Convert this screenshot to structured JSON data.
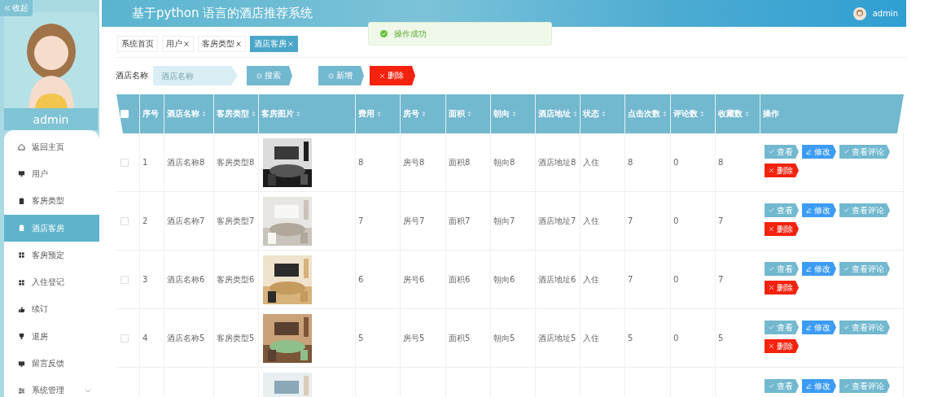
{
  "sidebar": {
    "collapse_label": "收起",
    "user_name": "admin",
    "menu": [
      {
        "label": "返回主页",
        "selected": false
      },
      {
        "label": "用户",
        "selected": false
      },
      {
        "label": "客房类型",
        "selected": false
      },
      {
        "label": "酒店客房",
        "selected": true
      },
      {
        "label": "客房预定",
        "selected": false
      },
      {
        "label": "入住登记",
        "selected": false
      },
      {
        "label": "续订",
        "selected": false
      },
      {
        "label": "退房",
        "selected": false
      },
      {
        "label": "留言反馈",
        "selected": false
      },
      {
        "label": "系统管理",
        "selected": false,
        "expandable": true
      }
    ]
  },
  "header": {
    "title": "基于python 语言的酒店推荐系统",
    "user": "admin"
  },
  "toast": {
    "message": "操作成功"
  },
  "tabs": [
    {
      "label": "系统首页",
      "closable": false,
      "selected": false
    },
    {
      "label": "用户",
      "closable": true,
      "selected": false
    },
    {
      "label": "客房类型",
      "closable": true,
      "selected": false
    },
    {
      "label": "酒店客房",
      "closable": true,
      "selected": true
    }
  ],
  "search": {
    "label": "酒店名称",
    "placeholder": "酒店名称",
    "buttons": [
      {
        "label": "搜索",
        "kind": "search"
      },
      {
        "label": "新增",
        "kind": "add"
      },
      {
        "label": "删除",
        "kind": "delete"
      }
    ]
  },
  "table": {
    "header_checkbox": {
      "checked": false
    },
    "columns": [
      {
        "label": "序号",
        "sortable": false
      },
      {
        "label": "酒店名称",
        "sortable": true
      },
      {
        "label": "客房类型",
        "sortable": true
      },
      {
        "label": "客房图片",
        "sortable": true
      },
      {
        "label": "费用",
        "sortable": true
      },
      {
        "label": "房号",
        "sortable": true
      },
      {
        "label": "面积",
        "sortable": true
      },
      {
        "label": "朝向",
        "sortable": true
      },
      {
        "label": "酒店地址",
        "sortable": true
      },
      {
        "label": "状态",
        "sortable": true
      },
      {
        "label": "点击次数",
        "sortable": true
      },
      {
        "label": "评论数",
        "sortable": true
      },
      {
        "label": "收藏数",
        "sortable": true
      },
      {
        "label": "操作",
        "sortable": false
      }
    ],
    "rows": [
      {
        "checked": false,
        "cells": [
          "1",
          "酒店名称8",
          "客房类型8",
          null,
          "8",
          "房号8",
          "面积8",
          "朝向8",
          "酒店地址8",
          "入住",
          "8",
          "0",
          "8"
        ],
        "actions": [
          {
            "label": "查看",
            "kind": "view"
          },
          {
            "label": "修改",
            "kind": "edit"
          },
          {
            "label": "查看评论",
            "kind": "view"
          },
          {
            "label": "删除",
            "kind": "delete"
          }
        ]
      },
      {
        "checked": false,
        "cells": [
          "2",
          "酒店名称7",
          "客房类型7",
          null,
          "7",
          "房号7",
          "面积7",
          "朝向7",
          "酒店地址7",
          "入住",
          "7",
          "0",
          "7"
        ],
        "actions": [
          {
            "label": "查看",
            "kind": "view"
          },
          {
            "label": "修改",
            "kind": "edit"
          },
          {
            "label": "查看评论",
            "kind": "view"
          },
          {
            "label": "删除",
            "kind": "delete"
          }
        ]
      },
      {
        "checked": false,
        "cells": [
          "3",
          "酒店名称6",
          "客房类型6",
          null,
          "6",
          "房号6",
          "面积6",
          "朝向6",
          "酒店地址6",
          "入住",
          "7",
          "0",
          "7"
        ],
        "actions": [
          {
            "label": "查看",
            "kind": "view"
          },
          {
            "label": "修改",
            "kind": "edit"
          },
          {
            "label": "查看评论",
            "kind": "view"
          },
          {
            "label": "删除",
            "kind": "delete"
          }
        ]
      },
      {
        "checked": false,
        "cells": [
          "4",
          "酒店名称5",
          "客房类型5",
          null,
          "5",
          "房号5",
          "面积5",
          "朝向5",
          "酒店地址5",
          "入住",
          "5",
          "0",
          "5"
        ],
        "actions": [
          {
            "label": "查看",
            "kind": "view"
          },
          {
            "label": "修改",
            "kind": "edit"
          },
          {
            "label": "查看评论",
            "kind": "view"
          },
          {
            "label": "删除",
            "kind": "delete"
          }
        ]
      },
      {
        "actions": [
          {
            "label": "查看",
            "kind": "view"
          },
          {
            "label": "修改",
            "kind": "edit"
          },
          {
            "label": "查看评论",
            "kind": "view"
          }
        ]
      }
    ]
  }
}
